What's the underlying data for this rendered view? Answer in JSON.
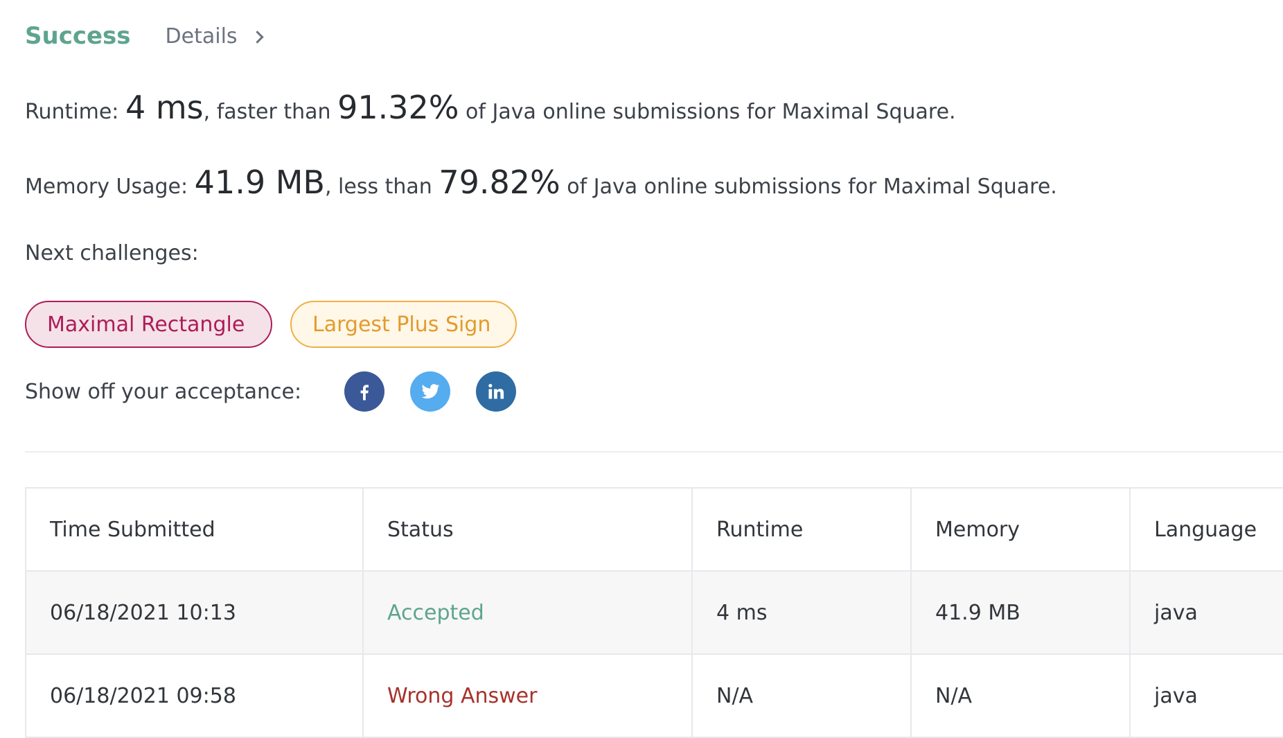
{
  "header": {
    "status": "Success",
    "details_link": "Details"
  },
  "runtime": {
    "label": "Runtime: ",
    "value": "4 ms",
    "compare": ", faster than ",
    "percent": "91.32%",
    "suffix": " of Java online submissions for Maximal Square."
  },
  "memory": {
    "label": "Memory Usage: ",
    "value": "41.9 MB",
    "compare": ", less than ",
    "percent": "79.82%",
    "suffix": " of Java online submissions for Maximal Square."
  },
  "next": {
    "label": "Next challenges:",
    "challenges": [
      {
        "title": "Maximal Rectangle",
        "difficulty_color": "#ad1c57"
      },
      {
        "title": "Largest Plus Sign",
        "difficulty_color": "#e29b2c"
      }
    ]
  },
  "share": {
    "label": "Show off your acceptance:",
    "icons": [
      "facebook-icon",
      "twitter-icon",
      "linkedin-icon"
    ]
  },
  "submissions": {
    "headers": [
      "Time Submitted",
      "Status",
      "Runtime",
      "Memory",
      "Language"
    ],
    "rows": [
      {
        "time": "06/18/2021 10:13",
        "status": "Accepted",
        "runtime": "4 ms",
        "memory": "41.9 MB",
        "language": "java"
      },
      {
        "time": "06/18/2021 09:58",
        "status": "Wrong Answer",
        "runtime": "N/A",
        "memory": "N/A",
        "language": "java"
      }
    ]
  },
  "colors": {
    "success": "#5ea48e",
    "error": "#a6322b",
    "facebook": "#3b5998",
    "twitter": "#55acee",
    "linkedin": "#2f6ca4"
  }
}
